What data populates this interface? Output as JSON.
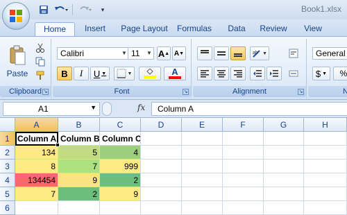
{
  "window": {
    "title": "Book1.xlsx"
  },
  "quick_access": {
    "save": "save-icon",
    "undo": "undo-icon",
    "redo": "redo-icon",
    "customize": "▾"
  },
  "tabs": [
    {
      "label": "Home",
      "active": true
    },
    {
      "label": "Insert"
    },
    {
      "label": "Page Layout"
    },
    {
      "label": "Formulas"
    },
    {
      "label": "Data"
    },
    {
      "label": "Review"
    },
    {
      "label": "View"
    }
  ],
  "ribbon": {
    "clipboard": {
      "label": "Clipboard",
      "paste": "Paste"
    },
    "font": {
      "label": "Font",
      "font_name": "Calibri",
      "font_size": "11",
      "grow": "A",
      "shrink": "A",
      "bold": "B",
      "italic": "I",
      "underline": "U",
      "font_color": "A",
      "fill_color": "#ffff00",
      "text_color": "#ff0000"
    },
    "alignment": {
      "label": "Alignment"
    },
    "number": {
      "label": "Nu",
      "format": "General",
      "currency": "$",
      "percent": "%",
      "comma": ",",
      "extra": ".x"
    }
  },
  "formula_bar": {
    "name_box": "A1",
    "fx": "fx",
    "formula": "Column A"
  },
  "grid": {
    "columns": [
      "A",
      "B",
      "C",
      "D",
      "E",
      "F",
      "G",
      "H"
    ],
    "selected_column": "A",
    "rows": [
      "1",
      "2",
      "3",
      "4",
      "5",
      "6"
    ],
    "selected_row": "1",
    "cells": {
      "A1": {
        "value": "Column A",
        "bold": true,
        "color": "#ffffff"
      },
      "B1": {
        "value": "Column B",
        "bold": true,
        "color": "#ffffff"
      },
      "C1": {
        "value": "Column C",
        "bold": true,
        "color": "#ffffff"
      },
      "A2": {
        "value": "134",
        "color": "#ffe984"
      },
      "B2": {
        "value": "5",
        "color": "#c3db80"
      },
      "C2": {
        "value": "4",
        "color": "#9cce7e"
      },
      "A3": {
        "value": "8",
        "color": "#ffeb84"
      },
      "B3": {
        "value": "7",
        "color": "#ade07e"
      },
      "C3": {
        "value": "999",
        "color": "#ffeb84"
      },
      "A4": {
        "value": "134454",
        "color": "#f8696b"
      },
      "B4": {
        "value": "9",
        "color": "#fbe383"
      },
      "C4": {
        "value": "2",
        "color": "#6bbe7b"
      },
      "A5": {
        "value": "7",
        "color": "#ffeb84"
      },
      "B5": {
        "value": "2",
        "color": "#6bbe7b"
      },
      "C5": {
        "value": "9",
        "color": "#ffeb84"
      }
    },
    "active_cell": "A1"
  }
}
